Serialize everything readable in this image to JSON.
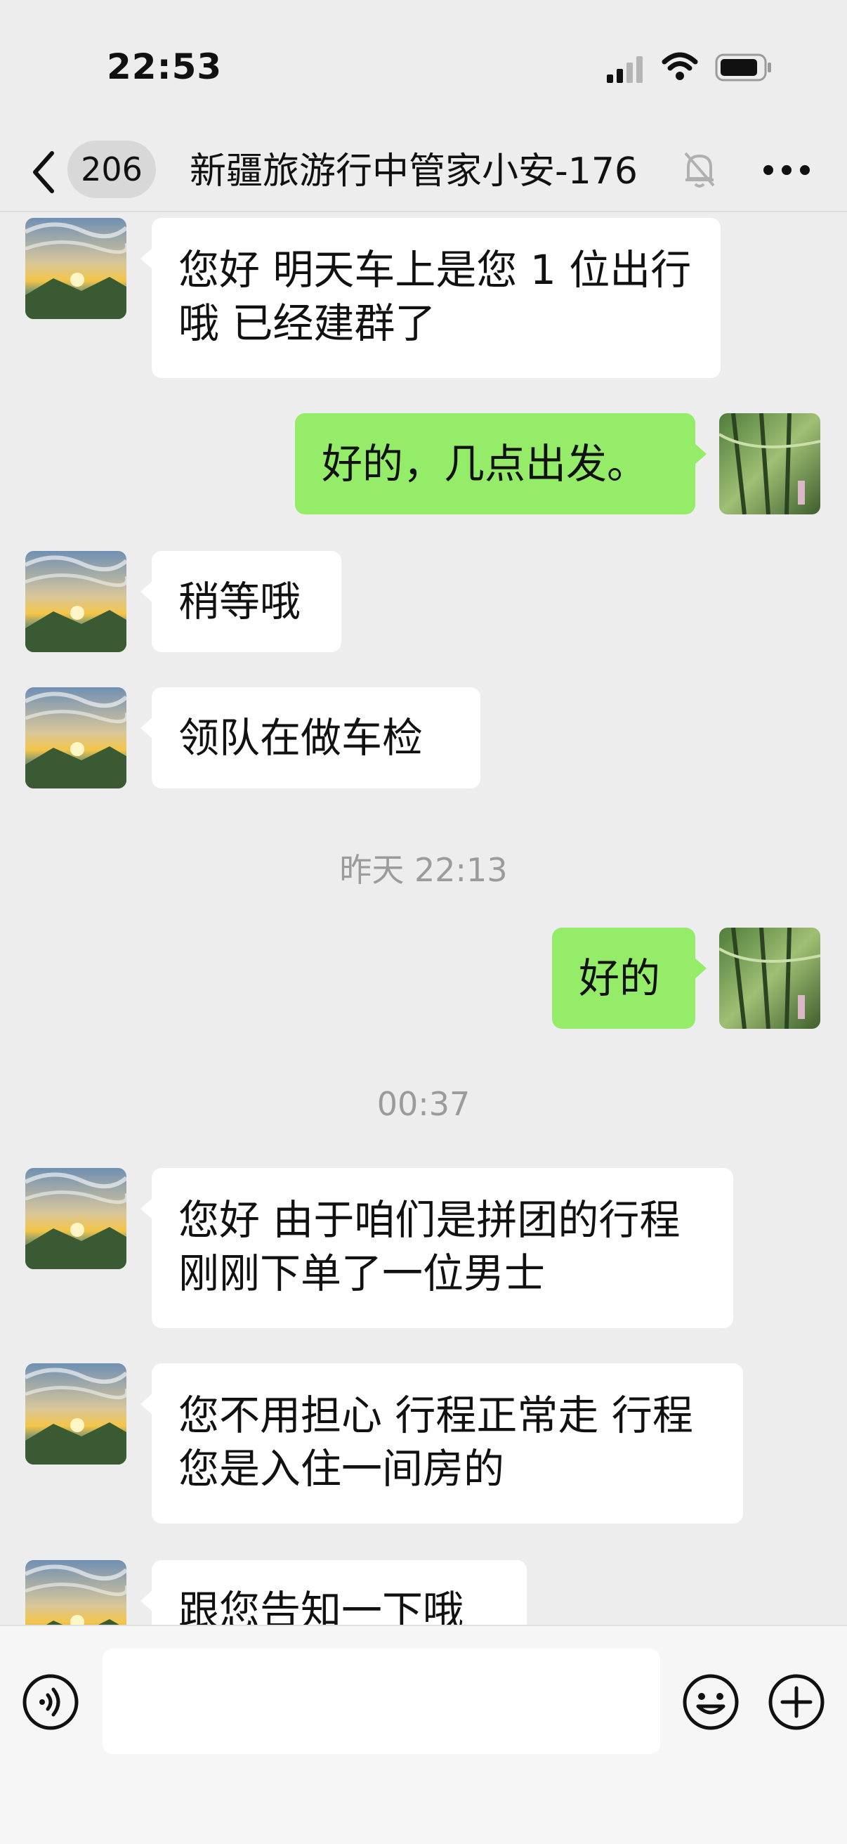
{
  "status_bar": {
    "time": "22:53"
  },
  "nav": {
    "unread_count": "206",
    "title": "新疆旅游行中管家小安-176"
  },
  "timestamps": [
    "昨天 22:13",
    "00:37"
  ],
  "messages": [
    {
      "side": "in",
      "text": "您好  明天车上是您 1 位出行哦 已经建群了"
    },
    {
      "side": "out",
      "text": "好的，几点出发。"
    },
    {
      "side": "in",
      "text": "稍等哦"
    },
    {
      "side": "in",
      "text": "领队在做车检"
    },
    {
      "side": "out",
      "text": "好的"
    },
    {
      "side": "in",
      "text": "您好  由于咱们是拼团的行程 刚刚下单了一位男士"
    },
    {
      "side": "in",
      "text": "您不用担心 行程正常走  行程您是入住一间房的"
    },
    {
      "side": "in",
      "text": "跟您告知一下哦"
    }
  ],
  "icons": {
    "back": "chevron-left-icon",
    "mute": "bell-off-icon",
    "more": "more-dots-icon",
    "voice": "voice-icon",
    "emoji": "emoji-icon",
    "plus": "plus-icon"
  },
  "colors": {
    "outgoing_bubble": "#95ec69",
    "incoming_bubble": "#ffffff",
    "chat_background": "#ededed"
  }
}
